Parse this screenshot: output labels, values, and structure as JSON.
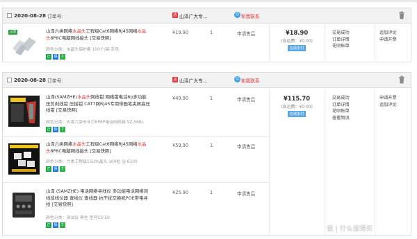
{
  "orders": [
    {
      "date": "2020-08-28",
      "order_no_label": "订单号:",
      "shop": "山泽广大专...",
      "contact": "和我联系",
      "total": "¥18.90",
      "freight": "(含运费：¥0.00)",
      "pay_method": "在线支付",
      "status": [
        "交易成功",
        "订单详情",
        "花呗账单"
      ],
      "ops": [
        "追加评论",
        "申请开票"
      ],
      "items": [
        {
          "badge": "山泽",
          "title_parts": [
            "山泽六类网络",
            "水晶头",
            "工程级Cat6网络RJ45网络",
            "水晶头",
            "8P8C电脑网线接头 [交易快照]"
          ],
          "spec": "颜色分类：水晶头保护套 100个/袋 灰色",
          "price": "¥19.90",
          "qty": "1",
          "after": "申请售后"
        }
      ]
    },
    {
      "date": "2020-08-28",
      "order_no_label": "订单号:",
      "shop": "山泽广大专...",
      "contact": "和我联系",
      "total": "¥115.70",
      "freight": "(含运费：¥0.00)",
      "pay_method": "在线支付",
      "status": [
        "交易成功",
        "订单详情",
        "花呗账单",
        "查看物流"
      ],
      "ops": [
        "申请开票",
        "追加评论"
      ],
      "items": [
        {
          "badge": "",
          "title_parts": [
            "山泽(SAMZHE)",
            "水晶头",
            "网线钳 网络钳电话6p多功能压剪剥线钳 压接钳 CAT7网RJ45专用带画笔夹屑高压线钳 [交易快照]"
          ],
          "spec": "颜色分类：五类六类专业打6P8P电话网线钳 SZ-568L",
          "price": "¥49.90",
          "qty": "1",
          "after": "申请售后"
        },
        {
          "badge": "",
          "title_parts": [
            "山泽六类网络",
            "水晶头",
            "工程级Cat6网络RJ45网络",
            "水晶头",
            "8P8C电脑网线接头 [交易快照]"
          ],
          "spec": "颜色分类：六类工程级15U水晶头 100粒 SJ-6100",
          "price": "¥59.90",
          "qty": "1",
          "after": "申请售后"
        },
        {
          "badge": "",
          "title_parts": [
            "山泽 (SAMZHE) 电话网络寻线仪 多功能电话网络测线巡线仪器 查线仪 查线器 抗干扰交换机POE带电寻线 [交易快照]"
          ],
          "spec": "颜色分类：测试仪 黑色 型号CS-50",
          "price": "¥25.90",
          "qty": "1",
          "after": "申请售后"
        }
      ]
    }
  ],
  "badges": [
    "正",
    "保",
    "7"
  ],
  "watermark": "值 | 什么值得买",
  "colors": {
    "accent_red": "#e4393c",
    "header_bg": "#f2f2f2",
    "link_blue": "#3fa2e8"
  }
}
